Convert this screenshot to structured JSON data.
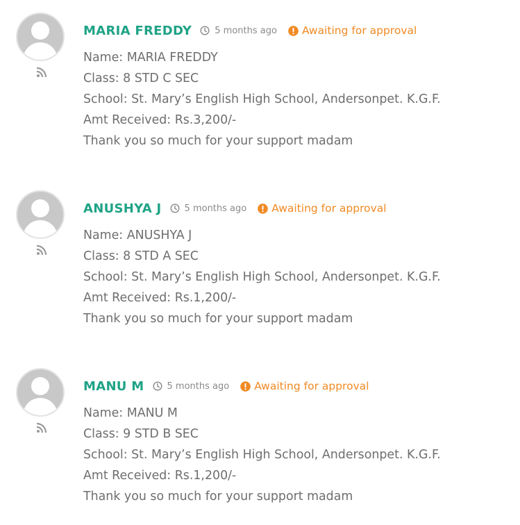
{
  "colors": {
    "author": "#1fa386",
    "status": "#f08a24",
    "text": "#6e6e6e",
    "time": "#8a8a8a"
  },
  "icons": {
    "avatar": "default-avatar-icon",
    "feed": "rss-icon",
    "time": "clock-icon",
    "status": "exclamation-circle-icon"
  },
  "comments": [
    {
      "author": "MARIA FREDDY",
      "time": "5 months ago",
      "status": "Awaiting for approval",
      "lines": [
        "Name: MARIA FREDDY",
        "Class: 8 STD C SEC",
        "School: St. Mary’s English High School, Andersonpet. K.G.F.",
        "Amt Received: Rs.3,200/-",
        "Thank you so much for your support madam"
      ]
    },
    {
      "author": "ANUSHYA J",
      "time": "5 months ago",
      "status": "Awaiting for approval",
      "lines": [
        "Name: ANUSHYA J",
        "Class: 8 STD A SEC",
        "School: St. Mary’s English High School, Andersonpet. K.G.F.",
        "Amt Received: Rs.1,200/-",
        "Thank you so much for your support madam"
      ]
    },
    {
      "author": "MANU M",
      "time": "5 months ago",
      "status": "Awaiting for approval",
      "lines": [
        "Name: MANU M",
        "Class: 9 STD B SEC",
        "School: St. Mary’s English High School, Andersonpet. K.G.F.",
        "Amt Received: Rs.1,200/-",
        "Thank you so much for your support madam"
      ]
    }
  ]
}
